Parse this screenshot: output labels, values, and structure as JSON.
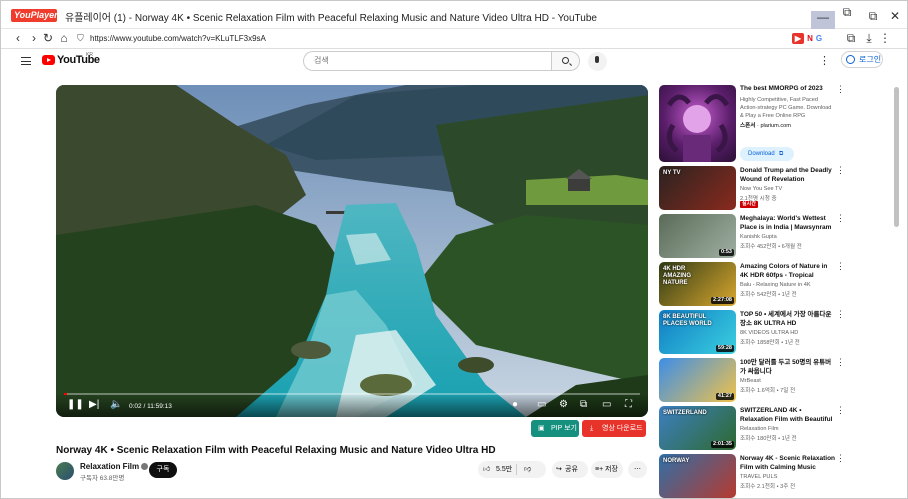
{
  "window": {
    "app_name": "YouPlayer",
    "title": "유플레이어 (1) - Norway 4K • Scenic Relaxation Film with Peaceful Relaxing Music and Nature Video Ultra HD - YouTube",
    "min_label": "—",
    "max_label": "⧉",
    "close_label": "✕"
  },
  "browser": {
    "url": "https://www.youtube.com/watch?v=KLuTLF3x9sA",
    "ext_netflix": "N",
    "ext_google": "G"
  },
  "header": {
    "logo_text": "YouTube",
    "region": "KR",
    "search_placeholder": "검색",
    "login_label": "로그인"
  },
  "player": {
    "time": "0:02 / 11:59:13",
    "progress": 0.003
  },
  "actions": {
    "pip_label": "PIP 보기",
    "download_label": "영상 다운로드"
  },
  "video": {
    "title": "Norway 4K • Scenic Relaxation Film with Peaceful Relaxing Music and Nature Video Ultra HD",
    "channel": "Relaxation Film",
    "subscribers": "구독자 63.8만명",
    "subscribe_label": "구독",
    "likes": "5.5만",
    "share_label": "공유",
    "save_label": "저장",
    "more_label": "⋯"
  },
  "ad": {
    "title": "The best MMORPG of 2023",
    "description": "Highly Competitive, Fast Paced Action-strategy PC Game. Download & Play a Free Online RPG",
    "sponsor_label": "스폰서",
    "sponsor_site": "plarium.com",
    "button_label": "Download"
  },
  "recommendations": [
    {
      "title": "Donald Trump and the Deadly Wound of Revelation",
      "channel": "Now You See TV",
      "meta": "2.1천명 시청 중",
      "badge": "실시간",
      "duration": "",
      "colors": [
        "#2a2320",
        "#8a2a1e"
      ]
    },
    {
      "title": "Meghalaya: World's Wettest Place is in India | Mawsynram ...",
      "channel": "Kanishk Gupta",
      "meta": "조회수 452만회 • 6개월 전",
      "badge": "",
      "duration": "0:53",
      "colors": [
        "#5b6b58",
        "#9fb0a3"
      ]
    },
    {
      "title": "Amazing Colors of Nature in 4K HDR 60fps - Tropical Animals...",
      "channel": "Balu - Relaxing Nature in 4K",
      "meta": "조회수 542만회 • 1년 전",
      "badge": "",
      "duration": "2:27:08",
      "colors": [
        "#2f3b16",
        "#d9a72e"
      ]
    },
    {
      "title": "TOP 50 • 세계에서 가장 아름다운 장소 8K ULTRA HD",
      "channel": "8K VIDEOS ULTRA HD",
      "meta": "조회수 1858만회 • 1년 전",
      "badge": "",
      "duration": "59:28",
      "colors": [
        "#0f7cc4",
        "#3bd0e0"
      ]
    },
    {
      "title": "100만 달러를 두고 50명의 유튜버가 싸웁니다",
      "channel": "MrBeast",
      "meta": "조회수 1.6억회 • 7일 전",
      "badge": "",
      "duration": "41:27",
      "colors": [
        "#3c8ee8",
        "#f0c24a"
      ]
    },
    {
      "title": "SWITZERLAND 4K • Relaxation Film with Beautiful Piano Musi...",
      "channel": "Relaxation Film",
      "meta": "조회수 180만회 • 1년 전",
      "badge": "",
      "duration": "2:01:35",
      "colors": [
        "#3c7fc2",
        "#2e6a2f"
      ]
    },
    {
      "title": "Norway 4K - Scenic Relaxation Film with Calming Music",
      "channel": "TRAVEL PULS",
      "meta": "조회수 2.1천회 • 3주 전",
      "badge": "",
      "duration": "",
      "colors": [
        "#2f6fa8",
        "#b63a2f"
      ]
    }
  ],
  "thumb_labels": {
    "trump": "NY TV",
    "tropical": "4K HDR AMAZING NATURE",
    "top50": "8K BEAUTIFUL PLACES WORLD",
    "switzerland": "SWITZERLAND",
    "norway": "NORWAY"
  }
}
